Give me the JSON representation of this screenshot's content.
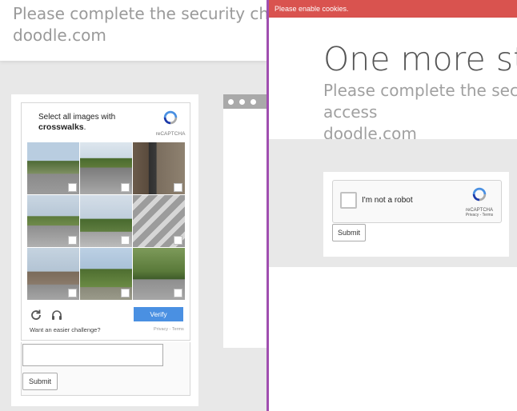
{
  "background_page": {
    "subtitle": "Please complete the security check to access",
    "domain": "doodle.com",
    "captcha": {
      "instruction": "Select all images with",
      "target": "crosswalks",
      "target_suffix": ".",
      "brand": "reCAPTCHA",
      "verify_label": "Verify",
      "easier_label": "Want an easier challenge?",
      "privacy_terms": "Privacy - Terms",
      "submit_label": "Submit"
    }
  },
  "front_window": {
    "cookie_notice": "Please enable cookies.",
    "title": "One more step",
    "subtitle": "Please complete the security check to access",
    "domain": "doodle.com",
    "checkbox_label": "I'm not a robot",
    "brand": "reCAPTCHA",
    "privacy_terms": "Privacy - Terms",
    "submit_label": "Submit"
  },
  "colors": {
    "cookie_bar": "#d9534f",
    "verify_button": "#4a90e2",
    "window_border": "#a04fb0"
  }
}
